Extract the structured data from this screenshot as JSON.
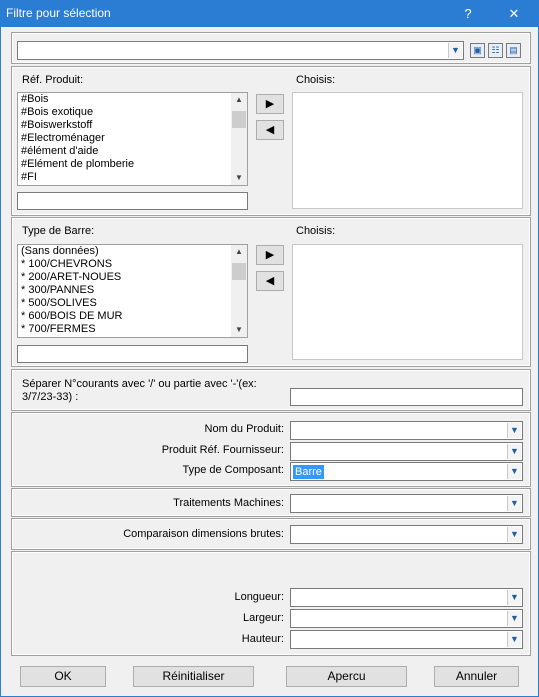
{
  "window": {
    "title": "Filtre pour sélection",
    "help_glyph": "?",
    "close_glyph": "✕"
  },
  "top": {
    "search_value": "",
    "icons": [
      "dropdown-arrow-icon",
      "save-icon",
      "tree-icon",
      "filter-settings-icon"
    ]
  },
  "ref_produit": {
    "label": "Réf. Produit:",
    "choisis_label": "Choisis:",
    "items": [
      "#Bois",
      "#Bois exotique",
      "#Boiswerkstoff",
      "#Electroménager",
      "#élément d'aide",
      "#Elément de plomberie",
      "#FI"
    ],
    "filter_value": "",
    "add_glyph": "▶",
    "remove_glyph": "◀"
  },
  "type_barre": {
    "label": "Type de Barre:",
    "choisis_label": "Choisis:",
    "items": [
      "(Sans données)",
      "* 100/CHEVRONS",
      "* 200/ARET-NOUES",
      "* 300/PANNES",
      "* 500/SOLIVES",
      "* 600/BOIS DE MUR",
      "* 700/FERMES"
    ],
    "filter_value": "",
    "add_glyph": "▶",
    "remove_glyph": "◀"
  },
  "separator": {
    "label": "Séparer N°courants avec '/' ou partie avec '-'(ex: 3/7/23-33) :",
    "value": ""
  },
  "fields": {
    "nom_produit": {
      "label": "Nom du Produit:",
      "value": ""
    },
    "produit_ref_fournisseur": {
      "label": "Produit Réf. Fournisseur:",
      "value": ""
    },
    "type_composant": {
      "label": "Type de Composant:",
      "value": "Barre"
    },
    "traitements_machines": {
      "label": "Traitements Machines:",
      "value": ""
    },
    "comparaison_dimensions": {
      "label": "Comparaison  dimensions brutes:",
      "value": ""
    },
    "longueur": {
      "label": "Longueur:",
      "value": ""
    },
    "largeur": {
      "label": "Largeur:",
      "value": ""
    },
    "hauteur": {
      "label": "Hauteur:",
      "value": ""
    }
  },
  "buttons": {
    "ok": "OK",
    "reset": "Réinitialiser",
    "preview": "Apercu",
    "cancel": "Annuler"
  },
  "colors": {
    "titlebar": "#2b7cd3",
    "selection": "#3399ff",
    "dialog_bg": "#f0f0f0"
  }
}
